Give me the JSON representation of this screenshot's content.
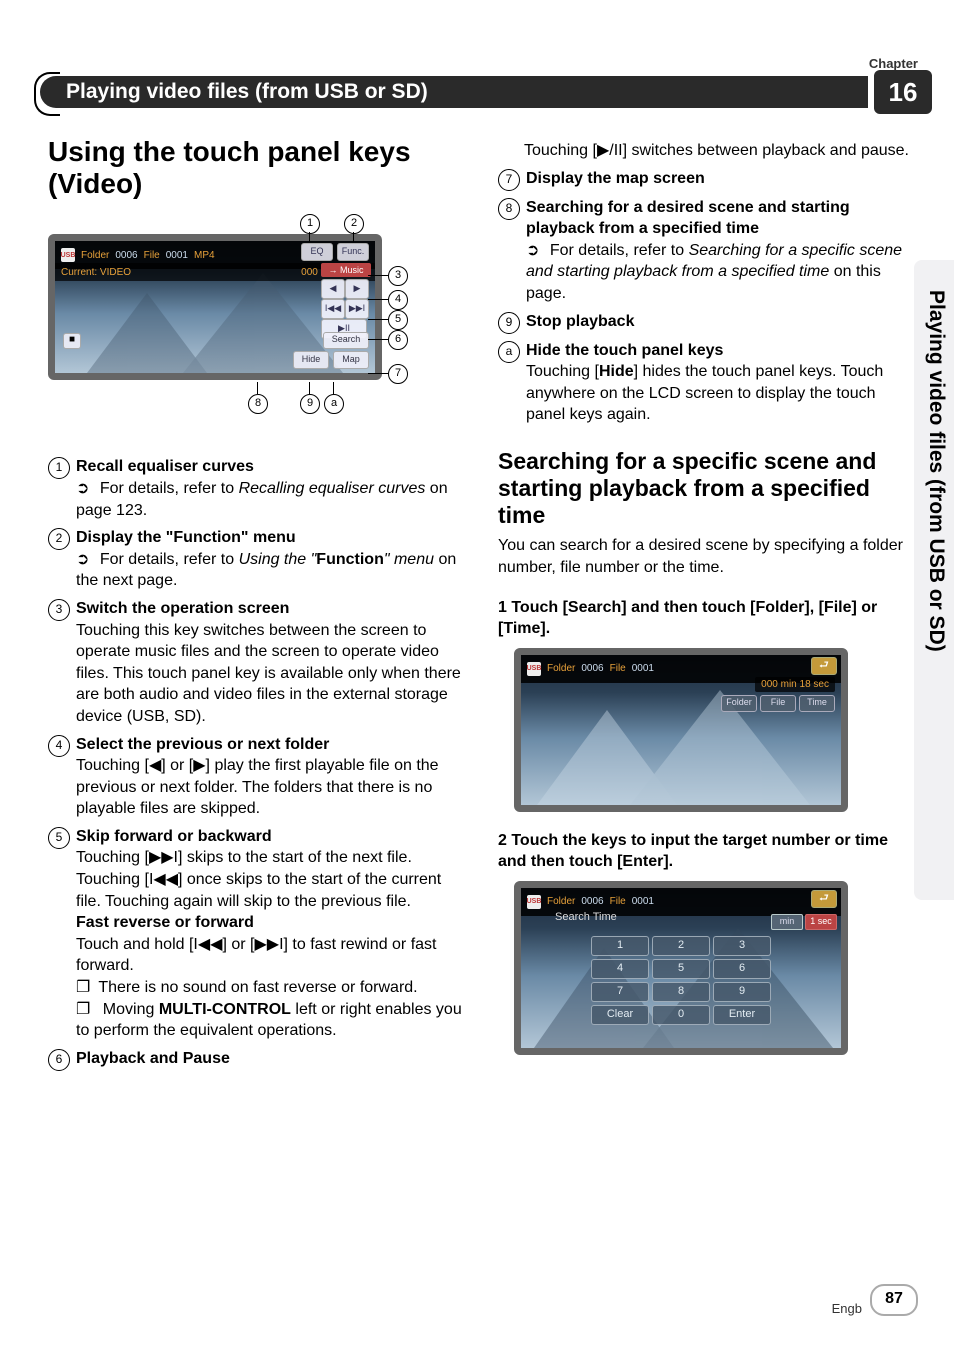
{
  "chapter_label": "Chapter",
  "chapter_num": "16",
  "title_bar": "Playing video files (from USB or SD)",
  "side_tab": "Playing video files (from USB or SD)",
  "page_number": "87",
  "lang": "Engb",
  "col1": {
    "h1": "Using the touch panel keys (Video)",
    "diagram": {
      "callouts": {
        "c1": "1",
        "c2": "2",
        "c3": "3",
        "c4": "4",
        "c5": "5",
        "c6": "6",
        "c7": "7",
        "c8": "8",
        "c9": "9",
        "c10": "a"
      },
      "shot": {
        "usb": "USB",
        "folder_label": "Folder",
        "folder_num": "0006",
        "file_label": "File",
        "file_num": "0001",
        "codec": "MP4",
        "current": "Current: VIDEO",
        "time": "000 min 09 sec",
        "eq": "EQ",
        "func": "Func.",
        "music": "→ Music",
        "prev": "◀",
        "next": "▶",
        "bpr": "I◀◀",
        "bnx": "▶▶I",
        "play": "▶II",
        "search": "Search",
        "stop": "■",
        "hide": "Hide",
        "map": "Map"
      }
    },
    "e1_head": "Recall equaliser curves",
    "e1_sub_prefix": "For details, refer to ",
    "e1_sub_italic": "Recalling equaliser curves",
    "e1_sub_suffix": " on page 123.",
    "e2_head": "Display the \"Function\" menu",
    "e2_sub_prefix": "For details, refer to ",
    "e2_sub_italic1": "Using the \"",
    "e2_sub_bold": "Function",
    "e2_sub_italic2": "\" menu",
    "e2_sub_suffix": " on the next page.",
    "e3_head": "Switch the operation screen",
    "e3_body": "Touching this key switches between the screen to operate music files and the screen to operate video files. This touch panel key is available only when there are both audio and video files in the external storage device (USB, SD).",
    "e4_head": "Select the previous or next folder",
    "e4_body": "Touching [◀] or [▶] play the first playable file on the previous or next folder. The folders that there is no playable files are skipped.",
    "e5_head": "Skip forward or backward",
    "e5_body": "Touching [▶▶I] skips to the start of the next file. Touching [I◀◀] once skips to the start of the current file. Touching again will skip to the previous file.",
    "e5_fast_head": "Fast reverse or forward",
    "e5_fast_body": "Touch and hold [I◀◀] or [▶▶I] to fast rewind or fast forward.",
    "e5_sq1": "There is no sound on fast reverse or forward.",
    "e5_sq2_pre": "Moving ",
    "e5_sq2_bold": "MULTI-CONTROL",
    "e5_sq2_post": " left or right enables you to perform the equivalent operations.",
    "e6_head": "Playback and Pause"
  },
  "col2": {
    "e6_body": "Touching [▶/II] switches between playback and pause.",
    "e7_head": "Display the map screen",
    "e8_head": "Searching for a desired scene and starting playback from a specified time",
    "e8_sub_prefix": "For details, refer to ",
    "e8_sub_italic": "Searching for a specific scene and starting playback from a specified time",
    "e8_sub_suffix": " on this page.",
    "e9_head": "Stop playback",
    "e10_head": "Hide the touch panel keys",
    "e10_body_pre": "Touching [",
    "e10_body_bold": "Hide",
    "e10_body_mid": "] hides the touch panel keys. Touch anywhere on the LCD screen to display the touch panel keys again.",
    "h2": "Searching for a specific scene and starting playback from a specified time",
    "h2_intro": "You can search for a desired scene by specifying a folder number, file number or the time.",
    "step1": "1   Touch [Search] and then touch [Folder], [File] or [Time].",
    "shot2": {
      "usb": "USB",
      "folder_label": "Folder",
      "folder_num": "0006",
      "file_label": "File",
      "file_num": "0001",
      "time": "000 min 18 sec",
      "tab1": "Folder",
      "tab2": "File",
      "tab3": "Time",
      "back": "⮐"
    },
    "step2": "2   Touch the keys to input the target number or time and then touch [Enter].",
    "shot3": {
      "usb": "USB",
      "folder_label": "Folder",
      "folder_num": "0006",
      "file_label": "File",
      "file_num": "0001",
      "search_label": "Search Time",
      "back": "⮐",
      "min": "min",
      "sec": "1 sec",
      "k1": "1",
      "k2": "2",
      "k3": "3",
      "k4": "4",
      "k5": "5",
      "k6": "6",
      "k7": "7",
      "k8": "8",
      "k9": "9",
      "kc": "Clear",
      "k0": "0",
      "ke": "Enter"
    }
  }
}
